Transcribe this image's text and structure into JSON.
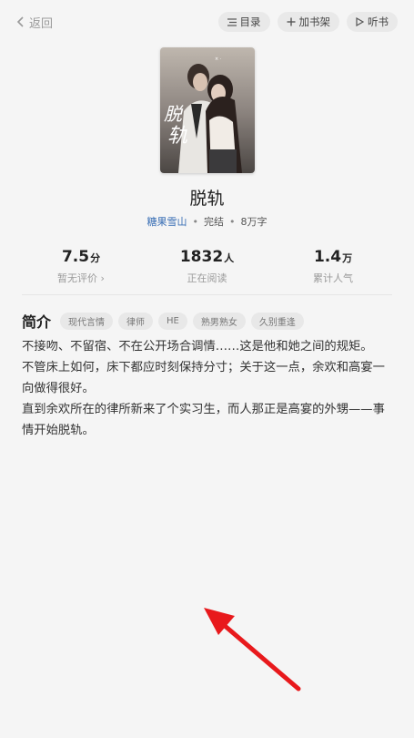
{
  "top_bar": {
    "back_label": "返回",
    "toc_label": "目录",
    "shelf_label": "加书架",
    "listen_label": "听书"
  },
  "book": {
    "title": "脱轨",
    "author": "糖果雪山",
    "status": "完结",
    "words": "8万字"
  },
  "stats": [
    {
      "value": "7.5",
      "unit": "分",
      "label": "暂无评价 ›"
    },
    {
      "value": "1832",
      "unit": "人",
      "label": "正在阅读"
    },
    {
      "value": "1.4",
      "unit": "万",
      "label": "累计人气"
    }
  ],
  "intro": {
    "heading": "简介",
    "tags": [
      "现代言情",
      "律师",
      "HE",
      "熟男熟女",
      "久别重逢"
    ],
    "paragraphs": [
      "不接吻、不留宿、不在公开场合调情……这是他和她之间的规矩。",
      "不管床上如何，床下都应时刻保持分寸；关于这一点，余欢和高宴一向做得很好。",
      "直到余欢所在的律所新来了个实习生，而人那正是高宴的外甥——事情开始脱轨。"
    ]
  },
  "colors": {
    "background": "#f5f5f5",
    "author_link": "#3a6fb5",
    "annotation_arrow": "#e8191c"
  }
}
